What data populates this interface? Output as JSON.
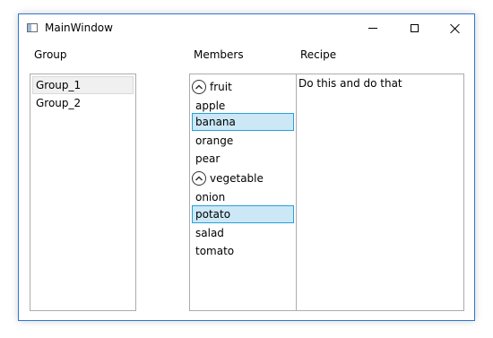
{
  "window": {
    "title": "MainWindow",
    "icons": {
      "app": "window-app-icon",
      "minimize": "minimize-icon",
      "maximize": "maximize-icon",
      "close": "close-icon"
    }
  },
  "labels": {
    "group": "Group",
    "members": "Members",
    "recipe": "Recipe"
  },
  "groups": {
    "items": [
      "Group_1",
      "Group_2"
    ],
    "selected": "Group_1"
  },
  "members": {
    "fruit": {
      "header": "fruit",
      "expander_icon": "chevron-up-icon",
      "items": [
        "apple",
        "banana",
        "orange",
        "pear"
      ]
    },
    "vegetable": {
      "header": "vegetable",
      "expander_icon": "chevron-up-icon",
      "items": [
        "onion",
        "potato",
        "salad",
        "tomato"
      ]
    },
    "selected": [
      "banana",
      "potato"
    ]
  },
  "recipe": {
    "text": "Do this and do that"
  }
}
